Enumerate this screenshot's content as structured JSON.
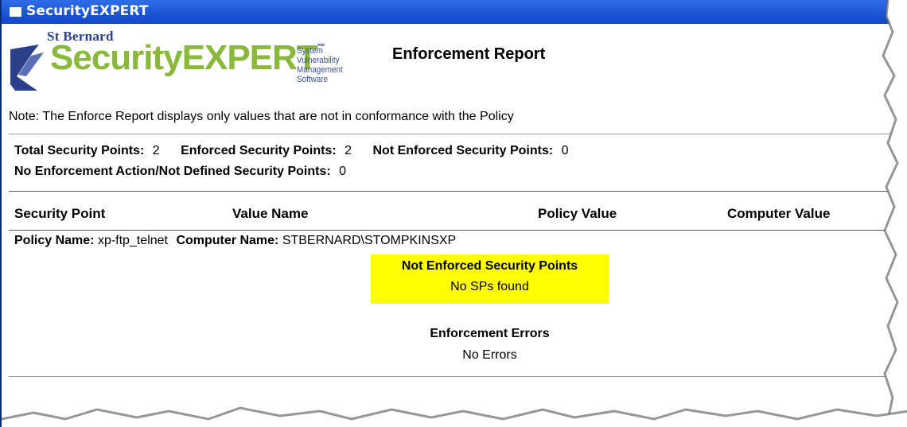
{
  "window": {
    "title": "SecurityEXPERT"
  },
  "logo": {
    "brand_top": "St Bernard",
    "brand_main": "SecurityEXPERT",
    "trademark": "™",
    "tagline": [
      "System",
      "Vulnerability",
      "Management",
      "Software"
    ]
  },
  "report": {
    "title": "Enforcement Report",
    "note": "Note: The Enforce Report displays only values that are not in conformance with the Policy"
  },
  "summary": {
    "total_label": "Total Security Points:",
    "total_value": "2",
    "enforced_label": "Enforced Security Points:",
    "enforced_value": "2",
    "not_enforced_label": "Not Enforced Security Points:",
    "not_enforced_value": "0",
    "no_action_label": "No Enforcement Action/Not Defined Security Points:",
    "no_action_value": "0"
  },
  "table": {
    "columns": [
      "Security Point",
      "Value Name",
      "Policy Value",
      "Computer Value"
    ]
  },
  "policy": {
    "policy_label": "Policy Name:",
    "policy_value": "xp-ftp_telnet",
    "computer_label": "Computer Name:",
    "computer_value": "STBERNARD\\STOMPKINSXP"
  },
  "sections": {
    "not_enforced_heading": "Not Enforced Security Points",
    "not_enforced_text": "No SPs found",
    "errors_heading": "Enforcement Errors",
    "errors_text": "No Errors"
  },
  "colors": {
    "titlebar": "#1a56d6",
    "highlight": "#ffff00",
    "logo_green": "#8ab83a",
    "logo_blue": "#2b3f8a"
  }
}
